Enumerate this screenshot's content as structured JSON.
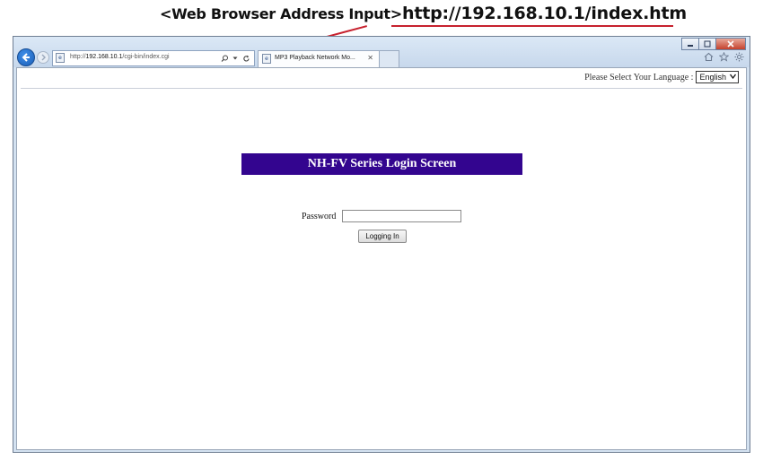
{
  "annotation": {
    "label": "<Web Browser Address Input>",
    "url": "http://192.168.10.1/index.htm",
    "accent_color": "#c7212e"
  },
  "browser": {
    "address": {
      "prefix": "http://",
      "host": "192.168.10.1",
      "path": "/cgi-bin/index.cgi"
    },
    "tab": {
      "title": "MP3 Playback Network Mo...",
      "close": "✕"
    },
    "window_buttons": [
      "minimize",
      "maximize",
      "close"
    ],
    "icons": [
      "back-icon",
      "forward-icon",
      "search-icon",
      "dropdown-icon",
      "refresh-icon",
      "home-icon",
      "star-icon",
      "gear-icon"
    ]
  },
  "page": {
    "language_prompt": "Please Select Your Language :",
    "language_selected": "English",
    "title": "NH-FV Series Login Screen",
    "title_bg": "#33058f",
    "password_label": "Password",
    "password_value": "",
    "login_button": "Logging In"
  }
}
